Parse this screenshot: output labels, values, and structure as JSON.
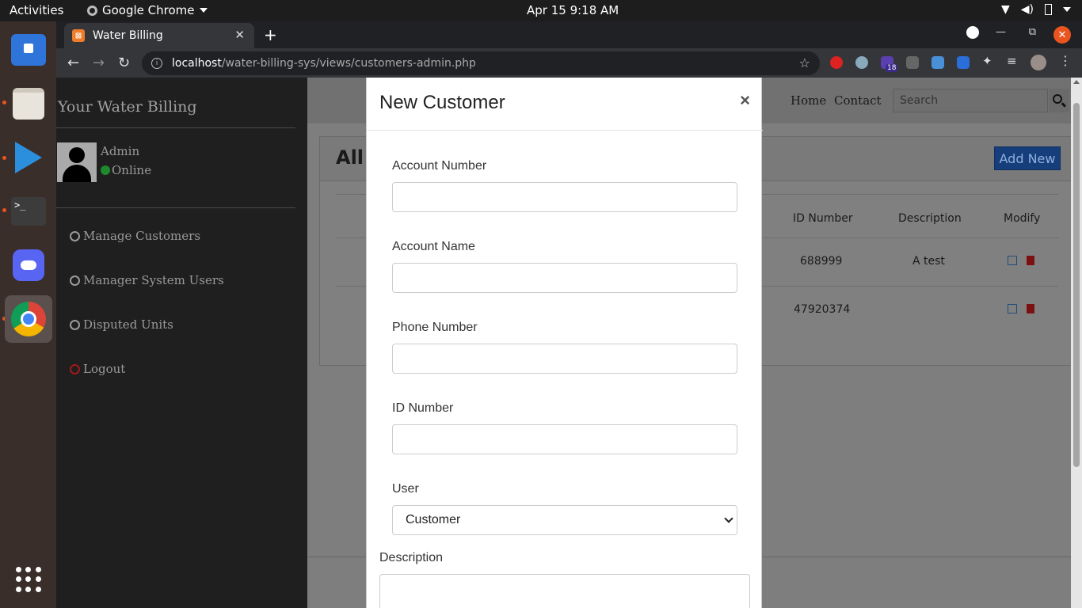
{
  "topbar": {
    "activities": "Activities",
    "app_name": "Google Chrome",
    "clock": "Apr 15  9:18 AM"
  },
  "dock": {
    "items": [
      "software-center",
      "files",
      "vscode",
      "terminal",
      "discord",
      "chrome"
    ],
    "terminal_prompt": ">_"
  },
  "browser": {
    "tab_title": "Water Billing",
    "url_host": "localhost",
    "url_path": "/water-billing-sys/views/customers-admin.php",
    "ext_badge": "18"
  },
  "sidebar": {
    "brand": "Your Water Billing",
    "user_name": "Admin",
    "user_status": "Online",
    "menu": [
      "Manage Customers",
      "Manager System Users",
      "Disputed Units",
      "Logout"
    ]
  },
  "navbar": {
    "home": "Home",
    "contact": "Contact",
    "search_placeholder": "Search"
  },
  "card": {
    "title_visible": "All C",
    "add_new": "Add New",
    "columns": [
      "ID Number",
      "Description",
      "Modify"
    ],
    "rows": [
      {
        "id_number": "688999",
        "description": "A test"
      },
      {
        "id_number": "47920374",
        "description": ""
      }
    ]
  },
  "modal": {
    "title": "New Customer",
    "close": "×",
    "fields": [
      {
        "label": "Account Number",
        "value": ""
      },
      {
        "label": "Account Name",
        "value": ""
      },
      {
        "label": "Phone Number",
        "value": ""
      },
      {
        "label": "ID Number",
        "value": ""
      }
    ],
    "user_label": "User",
    "user_selected": "Customer",
    "description_label": "Description"
  },
  "colors": {
    "accent": "#e95420",
    "online": "#1e8a2c",
    "add_new_bg": "#163e7a"
  }
}
